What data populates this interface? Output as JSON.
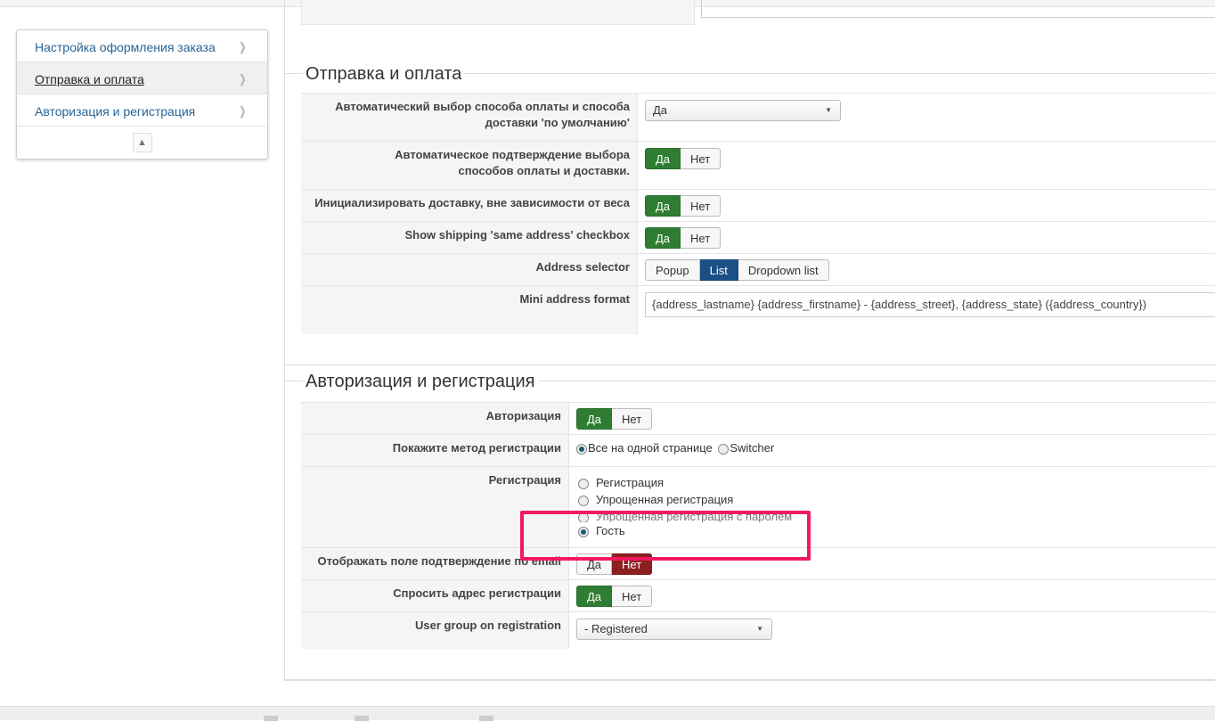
{
  "sidebar": {
    "items": [
      {
        "label": "Настройка оформления заказа",
        "active": false
      },
      {
        "label": "Отправка и оплата",
        "active": true
      },
      {
        "label": "Авторизация и регистрация",
        "active": false
      }
    ],
    "chevron_icon": "chevron-right-icon",
    "collapse_icon": "arrow-up-icon"
  },
  "shipping": {
    "legend": "Отправка и оплата",
    "auto_payment": {
      "label": "Автоматический выбор способа оплаты и способа доставки 'по умолчанию'",
      "value": "Да"
    },
    "auto_confirm": {
      "label": "Автоматическое подтверждение выбора способов оплаты и доставки.",
      "yes": "Да",
      "no": "Нет",
      "selected": "Да"
    },
    "init_shipping": {
      "label": "Инициализировать доставку, вне зависимости от веса",
      "yes": "Да",
      "no": "Нет",
      "selected": "Да"
    },
    "same_address": {
      "label": "Show shipping 'same address' checkbox",
      "yes": "Да",
      "no": "Нет",
      "selected": "Да"
    },
    "address_selector": {
      "label": "Address selector",
      "options": [
        "Popup",
        "List",
        "Dropdown list"
      ],
      "selected": "List"
    },
    "mini_address": {
      "label": "Mini address format",
      "value": "{address_lastname} {address_firstname} - {address_street}, {address_state} ({address_country})"
    }
  },
  "auth": {
    "legend": "Авторизация и регистрация",
    "authorization": {
      "label": "Авторизация",
      "yes": "Да",
      "no": "Нет",
      "selected": "Да"
    },
    "reg_method": {
      "label": "Покажите метод регистрации",
      "options": [
        "Все на одной странице",
        "Switcher"
      ],
      "selected": "Все на одной странице"
    },
    "registration": {
      "label": "Регистрация",
      "options": [
        "Регистрация",
        "Упрощенная регистрация",
        "Упрощенная регистрация с паролем",
        "Гость"
      ],
      "selected": "Гость"
    },
    "email_confirm": {
      "label": "Отображать поле подтверждение по email",
      "yes": "Да",
      "no": "Нет",
      "selected": "Нет"
    },
    "ask_address": {
      "label": "Спросить адрес регистрации",
      "yes": "Да",
      "no": "Нет",
      "selected": "Да"
    },
    "user_group": {
      "label": "User group on registration",
      "value": "- Registered"
    }
  },
  "colors": {
    "accent_green": "#2f7d32",
    "accent_red": "#8c2020",
    "accent_blue": "#1b4f86",
    "highlight": "#f2195f",
    "link": "#2a6496"
  }
}
